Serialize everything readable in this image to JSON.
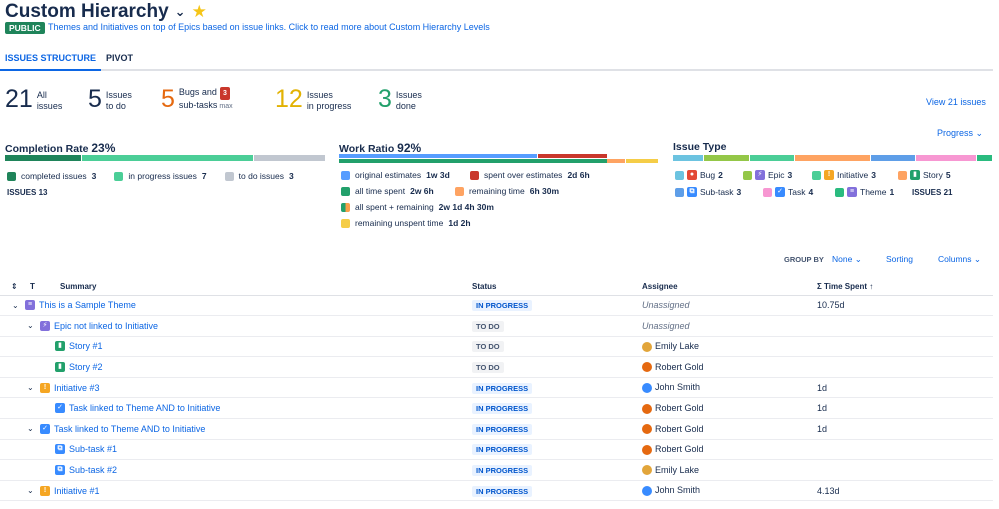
{
  "header": {
    "title": "Custom Hierarchy",
    "badge": "PUBLIC",
    "subtitle": "Themes and Initiatives on top of Epics based on issue links. Click to read more about Custom Hierarchy Levels"
  },
  "tabs": [
    "ISSUES STRUCTURE",
    "PIVOT"
  ],
  "counters": [
    {
      "num": "21",
      "line1": "All",
      "line2": "issues",
      "color": "#172b4d"
    },
    {
      "num": "5",
      "line1": "Issues",
      "line2": "to do",
      "color": "#172b4d"
    },
    {
      "num": "5",
      "line1": "Bugs and",
      "line2": "sub-tasks",
      "color": "#e56910",
      "badge": "3",
      "badge_sub": "max"
    },
    {
      "num": "12",
      "line1": "Issues",
      "line2": "in progress",
      "color": "#e2b203"
    },
    {
      "num": "3",
      "line1": "Issues",
      "line2": "done",
      "color": "#22a06b"
    }
  ],
  "view_all": "View 21 issues",
  "progress_btn": "Progress",
  "completion": {
    "label": "Completion Rate",
    "value": "23%",
    "legend": [
      {
        "label": "completed issues",
        "value": "3",
        "color": "#1f845a"
      },
      {
        "label": "in progress issues",
        "value": "7",
        "color": "#4bce97"
      },
      {
        "label": "to do issues",
        "value": "3",
        "color": "#c1c7d0"
      }
    ],
    "issues_label": "ISSUES",
    "issues_count": "13"
  },
  "work_ratio": {
    "label": "Work Ratio",
    "value": "92%",
    "legend": [
      {
        "label": "original estimates",
        "value": "1w 3d",
        "color": "#579dff"
      },
      {
        "label": "spent over estimates",
        "value": "2d 6h",
        "color": "#c9372c"
      },
      {
        "label": "all time spent",
        "value": "2w 6h",
        "color": "#22a06b"
      },
      {
        "label": "remaining time",
        "value": "6h 30m",
        "color": "#fea362"
      },
      {
        "label": "all spent + remaining",
        "value": "2w 1d 4h 30m",
        "color": "#22a06b",
        "color2": "#f8a04a"
      },
      {
        "label": "remaining unspent time",
        "value": "1d 2h",
        "color": "#f5cd47"
      }
    ]
  },
  "issue_type": {
    "label": "Issue Type",
    "legend": [
      {
        "label": "Bug",
        "value": "2",
        "color": "#6cc3e0",
        "icon": "bug-icon",
        "icocolor": "#e34935",
        "glyph": "●"
      },
      {
        "label": "Epic",
        "value": "3",
        "color": "#94c748",
        "icon": "epic-icon",
        "icocolor": "#8270db",
        "glyph": "⚡"
      },
      {
        "label": "Initiative",
        "value": "3",
        "color": "#4bce97",
        "icon": "initiative-icon",
        "icocolor": "#f5a623",
        "glyph": "!"
      },
      {
        "label": "Story",
        "value": "5",
        "color": "#fea362",
        "icon": "story-icon",
        "icocolor": "#22a06b",
        "glyph": "▮"
      },
      {
        "label": "Sub-task",
        "value": "3",
        "color": "#5e9ee8",
        "icon": "subtask-icon",
        "icocolor": "#388bff",
        "glyph": "⧉"
      },
      {
        "label": "Task",
        "value": "4",
        "color": "#f797d2",
        "icon": "task-icon",
        "icocolor": "#388bff",
        "glyph": "✓"
      },
      {
        "label": "Theme",
        "value": "1",
        "color": "#2abb7f",
        "icon": "theme-icon",
        "icocolor": "#8270db",
        "glyph": "≡"
      }
    ],
    "issues_label": "ISSUES",
    "issues_count": "21"
  },
  "toolbar": {
    "group_by_label": "GROUP BY",
    "group_by_value": "None",
    "sorting": "Sorting",
    "columns": "Columns"
  },
  "table": {
    "headers": {
      "t": "T",
      "summary": "Summary",
      "status": "Status",
      "assignee": "Assignee",
      "time": "Σ Time Spent"
    },
    "rows": [
      {
        "level": 0,
        "expand": "⌄",
        "icon": "theme-icon",
        "summary": "This is a Sample Theme",
        "status": "IN PROGRESS",
        "assignee": "Unassigned",
        "avatar": "",
        "time": "10.75d"
      },
      {
        "level": 1,
        "expand": "⌄",
        "icon": "epic-icon",
        "summary": "Epic not linked to Initiative",
        "status": "TO DO",
        "assignee": "Unassigned",
        "avatar": "",
        "time": ""
      },
      {
        "level": 2,
        "expand": "",
        "icon": "story-icon",
        "summary": "Story #1",
        "status": "TO DO",
        "assignee": "Emily Lake",
        "avatar": "#e2a53a",
        "time": ""
      },
      {
        "level": 2,
        "expand": "",
        "icon": "story-icon",
        "summary": "Story #2",
        "status": "TO DO",
        "assignee": "Robert Gold",
        "avatar": "#e56910",
        "time": ""
      },
      {
        "level": 1,
        "expand": "⌄",
        "icon": "initiative-icon",
        "summary": "Initiative #3",
        "status": "IN PROGRESS",
        "assignee": "John Smith",
        "avatar": "#388bff",
        "time": "1d"
      },
      {
        "level": 2,
        "expand": "",
        "icon": "task-icon",
        "summary": "Task linked to Theme AND to Initiative",
        "status": "IN PROGRESS",
        "assignee": "Robert Gold",
        "avatar": "#e56910",
        "time": "1d"
      },
      {
        "level": 1,
        "expand": "⌄",
        "icon": "task-icon",
        "summary": "Task linked to Theme AND to Initiative",
        "status": "IN PROGRESS",
        "assignee": "Robert Gold",
        "avatar": "#e56910",
        "time": "1d"
      },
      {
        "level": 2,
        "expand": "",
        "icon": "subtask-icon",
        "summary": "Sub-task #1",
        "status": "IN PROGRESS",
        "assignee": "Robert Gold",
        "avatar": "#e56910",
        "time": ""
      },
      {
        "level": 2,
        "expand": "",
        "icon": "subtask-icon",
        "summary": "Sub-task #2",
        "status": "IN PROGRESS",
        "assignee": "Emily Lake",
        "avatar": "#e2a53a",
        "time": ""
      },
      {
        "level": 1,
        "expand": "⌄",
        "icon": "initiative-icon",
        "summary": "Initiative #1",
        "status": "IN PROGRESS",
        "assignee": "John Smith",
        "avatar": "#388bff",
        "time": "4.13d"
      }
    ]
  }
}
